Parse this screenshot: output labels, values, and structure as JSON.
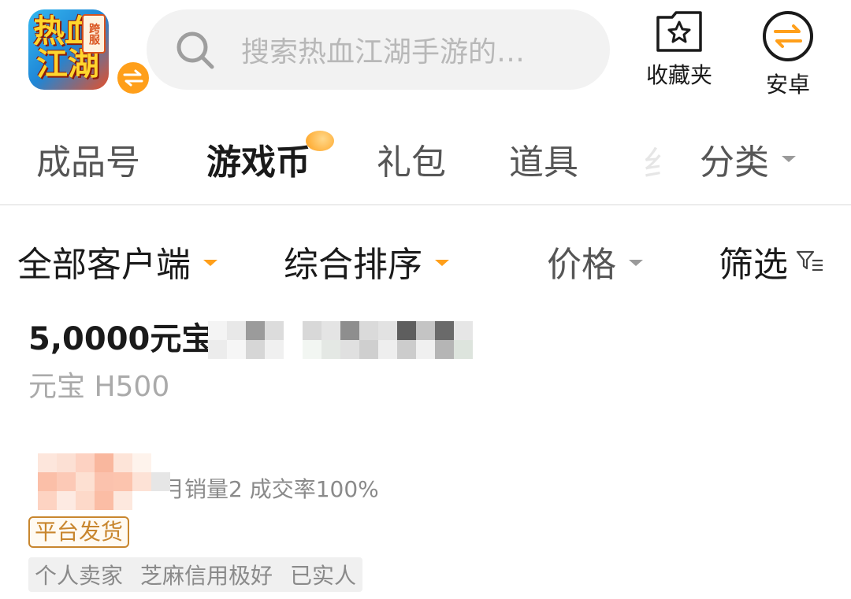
{
  "header": {
    "app_icon_name": "game-app-icon",
    "app_icon_corner_text": "跨服",
    "app_icon_art_line1": "热血",
    "app_icon_art_line2": "江湖",
    "search_placeholder": "搜索热血江湖手游的…",
    "favorites_label": "收藏夹",
    "platform_label": "安卓"
  },
  "tabs": [
    {
      "label": "成品号",
      "active": false
    },
    {
      "label": "游戏币",
      "active": true
    },
    {
      "label": "礼包",
      "active": false
    },
    {
      "label": "道具",
      "active": false
    },
    {
      "label": "分类",
      "active": false
    }
  ],
  "filters": {
    "client": "全部客户端",
    "sort": "综合排序",
    "price": "价格",
    "filter": "筛选"
  },
  "listing": {
    "title": "5,0000元宝",
    "subtitle": "元宝 H500",
    "seller_stats": "月销量2 成交率100%",
    "shipping_badge": "平台发货",
    "tags": [
      "个人卖家",
      "芝麻信用极好",
      "已实人"
    ]
  },
  "colors": {
    "accent": "#ff9f1a",
    "badge_border": "#c8862e",
    "muted_text": "#8a8a8a"
  }
}
